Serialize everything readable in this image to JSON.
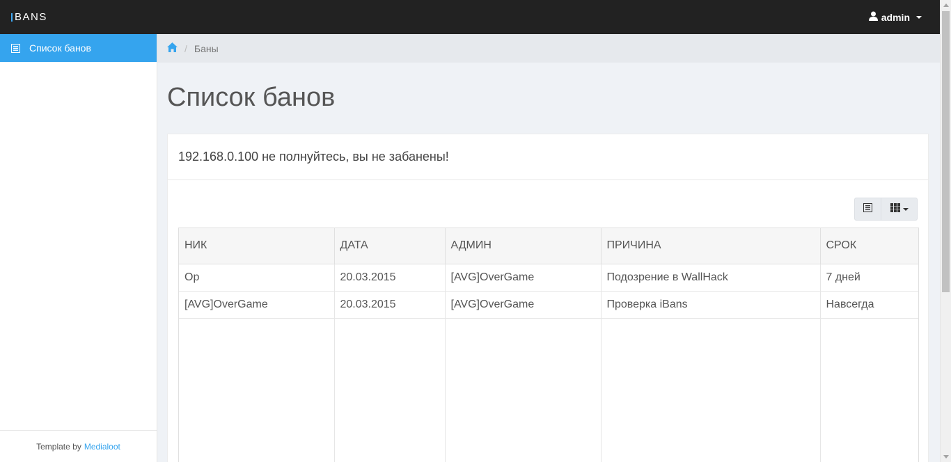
{
  "navbar": {
    "brand": "BANS",
    "user": "admin",
    "icons": {
      "user": "user-icon",
      "caret": "caret-down-icon"
    },
    "accent": "#3fa9f5"
  },
  "sidebar": {
    "items": [
      {
        "label": "Список банов",
        "icon": "list-icon",
        "active": true
      }
    ],
    "footer": {
      "prefix": "Template by",
      "link": "Medialoot"
    }
  },
  "breadcrumb": {
    "home_icon": "home-icon",
    "current": "Баны"
  },
  "page": {
    "title": "Список банов"
  },
  "panel": {
    "message": "192.168.0.100 не полнуйтесь, вы не забанены!",
    "toolbar": [
      {
        "icon": "list-view-icon"
      },
      {
        "icon": "columns-grid-icon",
        "dropdown": true
      }
    ]
  },
  "table": {
    "columns": [
      "НИК",
      "ДАТА",
      "АДМИН",
      "ПРИЧИНА",
      "СРОК"
    ],
    "rows": [
      [
        "Op",
        "20.03.2015",
        "[AVG]OverGame",
        "Подозрение в WallHack",
        "7 дней"
      ],
      [
        "[AVG]OverGame",
        "20.03.2015",
        "[AVG]OverGame",
        "Проверка iBans",
        "Навсегда"
      ]
    ]
  },
  "colors": {
    "navbar_bg": "#222222",
    "active_item": "#35a4ee",
    "link": "#35a4ee",
    "body_bg": "#eff2f6"
  }
}
